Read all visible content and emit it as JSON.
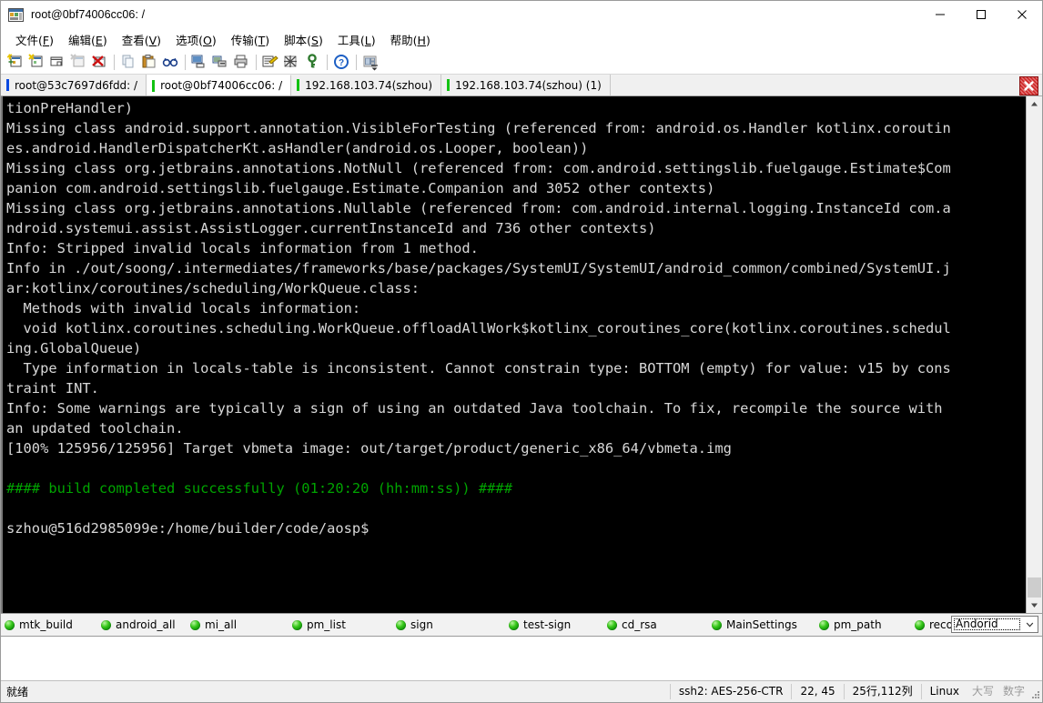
{
  "window": {
    "title": "root@0bf74006cc06: /",
    "icon": "terminal-app-icon",
    "minimize_label": "—",
    "maximize_label": "☐",
    "close_label": "✕"
  },
  "menubar": {
    "items": [
      {
        "label": "文件",
        "accel": "F"
      },
      {
        "label": "编辑",
        "accel": "E"
      },
      {
        "label": "查看",
        "accel": "V"
      },
      {
        "label": "选项",
        "accel": "O"
      },
      {
        "label": "传输",
        "accel": "T"
      },
      {
        "label": "脚本",
        "accel": "S"
      },
      {
        "label": "工具",
        "accel": "L"
      },
      {
        "label": "帮助",
        "accel": "H"
      }
    ]
  },
  "toolbar": {
    "buttons": [
      {
        "name": "new-session-icon",
        "title": "新建会话"
      },
      {
        "name": "quick-connect-icon",
        "title": "快速连接"
      },
      {
        "name": "clone-session-icon",
        "title": "克隆会话"
      },
      {
        "name": "reconnect-icon",
        "title": "重新连接"
      },
      {
        "name": "disconnect-icon",
        "title": "断开连接"
      },
      {
        "name": "copy-icon",
        "title": "复制"
      },
      {
        "name": "paste-icon",
        "title": "粘贴"
      },
      {
        "name": "find-icon",
        "title": "查找"
      },
      {
        "name": "print-screen-icon",
        "title": "打印屏幕"
      },
      {
        "name": "log-session-icon",
        "title": "记录会话"
      },
      {
        "name": "print-icon",
        "title": "打印"
      },
      {
        "name": "session-options-icon",
        "title": "会话选项"
      },
      {
        "name": "global-options-icon",
        "title": "全局选项"
      },
      {
        "name": "key-icon",
        "title": "公钥管理"
      },
      {
        "name": "help-icon",
        "title": "帮助"
      },
      {
        "name": "arrange-icon",
        "title": "排列窗口"
      }
    ],
    "overflow_label": "▾"
  },
  "tabs": {
    "items": [
      {
        "label": "root@53c7697d6fdd: /",
        "marker_color": "#0a49e0",
        "active": false
      },
      {
        "label": "root@0bf74006cc06: /",
        "marker_color": "#12c212",
        "active": true
      },
      {
        "label": "192.168.103.74(szhou)",
        "marker_color": "#12c212",
        "active": false
      },
      {
        "label": "192.168.103.74(szhou) (1)",
        "marker_color": "#12c212",
        "active": false
      }
    ],
    "close_button": {
      "name": "tab-close-button",
      "label": "✕",
      "color": "#cf2525"
    }
  },
  "terminal": {
    "background": "#000000",
    "foreground": "#d8d8d8",
    "success_color": "#00a400",
    "lines": [
      {
        "text": "tionPreHandler)",
        "color": "normal"
      },
      {
        "text": "Missing class android.support.annotation.VisibleForTesting (referenced from: android.os.Handler kotlinx.coroutin",
        "color": "normal"
      },
      {
        "text": "es.android.HandlerDispatcherKt.asHandler(android.os.Looper, boolean))",
        "color": "normal"
      },
      {
        "text": "Missing class org.jetbrains.annotations.NotNull (referenced from: com.android.settingslib.fuelgauge.Estimate$Com",
        "color": "normal"
      },
      {
        "text": "panion com.android.settingslib.fuelgauge.Estimate.Companion and 3052 other contexts)",
        "color": "normal"
      },
      {
        "text": "Missing class org.jetbrains.annotations.Nullable (referenced from: com.android.internal.logging.InstanceId com.a",
        "color": "normal"
      },
      {
        "text": "ndroid.systemui.assist.AssistLogger.currentInstanceId and 736 other contexts)",
        "color": "normal"
      },
      {
        "text": "Info: Stripped invalid locals information from 1 method.",
        "color": "normal"
      },
      {
        "text": "Info in ./out/soong/.intermediates/frameworks/base/packages/SystemUI/SystemUI/android_common/combined/SystemUI.j",
        "color": "normal"
      },
      {
        "text": "ar:kotlinx/coroutines/scheduling/WorkQueue.class:",
        "color": "normal"
      },
      {
        "text": "  Methods with invalid locals information:",
        "color": "normal"
      },
      {
        "text": "  void kotlinx.coroutines.scheduling.WorkQueue.offloadAllWork$kotlinx_coroutines_core(kotlinx.coroutines.schedul",
        "color": "normal"
      },
      {
        "text": "ing.GlobalQueue)",
        "color": "normal"
      },
      {
        "text": "  Type information in locals-table is inconsistent. Cannot constrain type: BOTTOM (empty) for value: v15 by cons",
        "color": "normal"
      },
      {
        "text": "traint INT.",
        "color": "normal"
      },
      {
        "text": "Info: Some warnings are typically a sign of using an outdated Java toolchain. To fix, recompile the source with",
        "color": "normal"
      },
      {
        "text": "an updated toolchain.",
        "color": "normal"
      },
      {
        "text": "[100% 125956/125956] Target vbmeta image: out/target/product/generic_x86_64/vbmeta.img",
        "color": "normal"
      },
      {
        "text": "",
        "color": "normal"
      },
      {
        "text": "#### build completed successfully (01:20:20 (hh:mm:ss)) ####",
        "color": "green"
      },
      {
        "text": "",
        "color": "normal"
      },
      {
        "text": "szhou@516d2985099e:/home/builder/code/aosp$",
        "color": "normal"
      }
    ],
    "scrollbar": {
      "up_label": "▲",
      "down_label": "▼"
    }
  },
  "button_bar": {
    "buttons": [
      {
        "label": "mtk_build"
      },
      {
        "label": "android_all"
      },
      {
        "label": "mi_all"
      },
      {
        "label": "pm_list"
      },
      {
        "label": "sign"
      },
      {
        "label": "test-sign"
      },
      {
        "label": "cd_rsa"
      },
      {
        "label": "MainSettings"
      },
      {
        "label": "pm_path"
      },
      {
        "label": "recovery"
      }
    ],
    "selector": {
      "value": "Andorid",
      "arrow": "∨"
    }
  },
  "statusbar": {
    "ready_text": "就绪",
    "cells": [
      {
        "text": "ssh2: AES-256-CTR",
        "dim": false
      },
      {
        "text": "22, 45",
        "dim": false
      },
      {
        "text": "25行,112列",
        "dim": false
      },
      {
        "text": "Linux",
        "dim": false
      },
      {
        "text": "大写",
        "dim": true
      },
      {
        "text": "数字",
        "dim": true
      }
    ]
  }
}
